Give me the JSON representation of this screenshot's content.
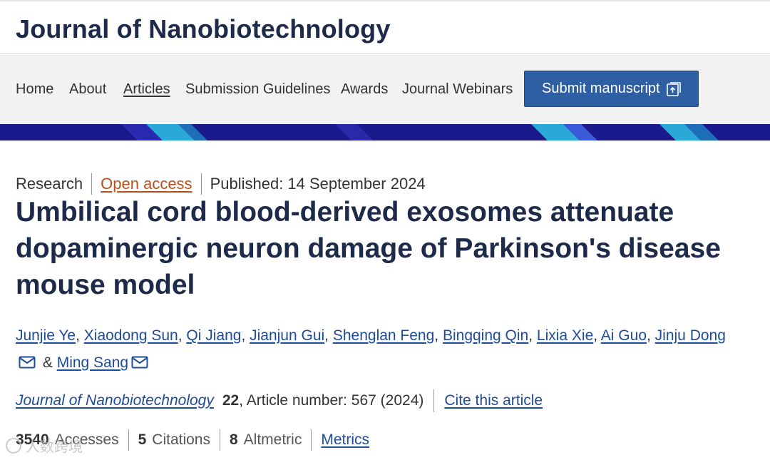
{
  "header": {
    "journal_title": "Journal of Nanobiotechnology"
  },
  "nav": {
    "items": [
      "Home",
      "About",
      "Articles",
      "Submission Guidelines",
      "Awards",
      "Journal Webinars"
    ],
    "active": "Articles",
    "submit_label": "Submit manuscript"
  },
  "article": {
    "type": "Research",
    "access": "Open access",
    "published": "Published: 14 September 2024",
    "title": "Umbilical cord blood-derived exosomes attenuate dopaminergic neuron damage of Parkinson's disease mouse model",
    "authors": [
      "Junjie Ye",
      "Xiaodong Sun",
      "Qi Jiang",
      "Jianjun Gui",
      "Shenglan Feng",
      "Bingqing Qin",
      "Lixia Xie",
      "Ai Guo",
      "Jinju Dong",
      "Ming Sang"
    ],
    "author_conjunction": "&",
    "citation": {
      "journal": "Journal of Nanobiotechnology",
      "volume": "22",
      "article_number": ", Article number: 567 (2024)",
      "cite_label": "Cite this article"
    },
    "metrics": {
      "accesses_value": "3540",
      "accesses_label": "Accesses",
      "citations_value": "5",
      "citations_label": "Citations",
      "altmetric_value": "8",
      "altmetric_label": "Altmetric",
      "metrics_link": "Metrics"
    }
  },
  "watermark": {
    "text": "人数跨境"
  },
  "colors": {
    "brand_navy": "#1e2a4a",
    "link_blue": "#1f4b99",
    "open_access_orange": "#b8501e",
    "submit_button": "#2e5fa3",
    "band_navy": "#1a1a8c",
    "band_cyan": "#2aa8d8"
  }
}
